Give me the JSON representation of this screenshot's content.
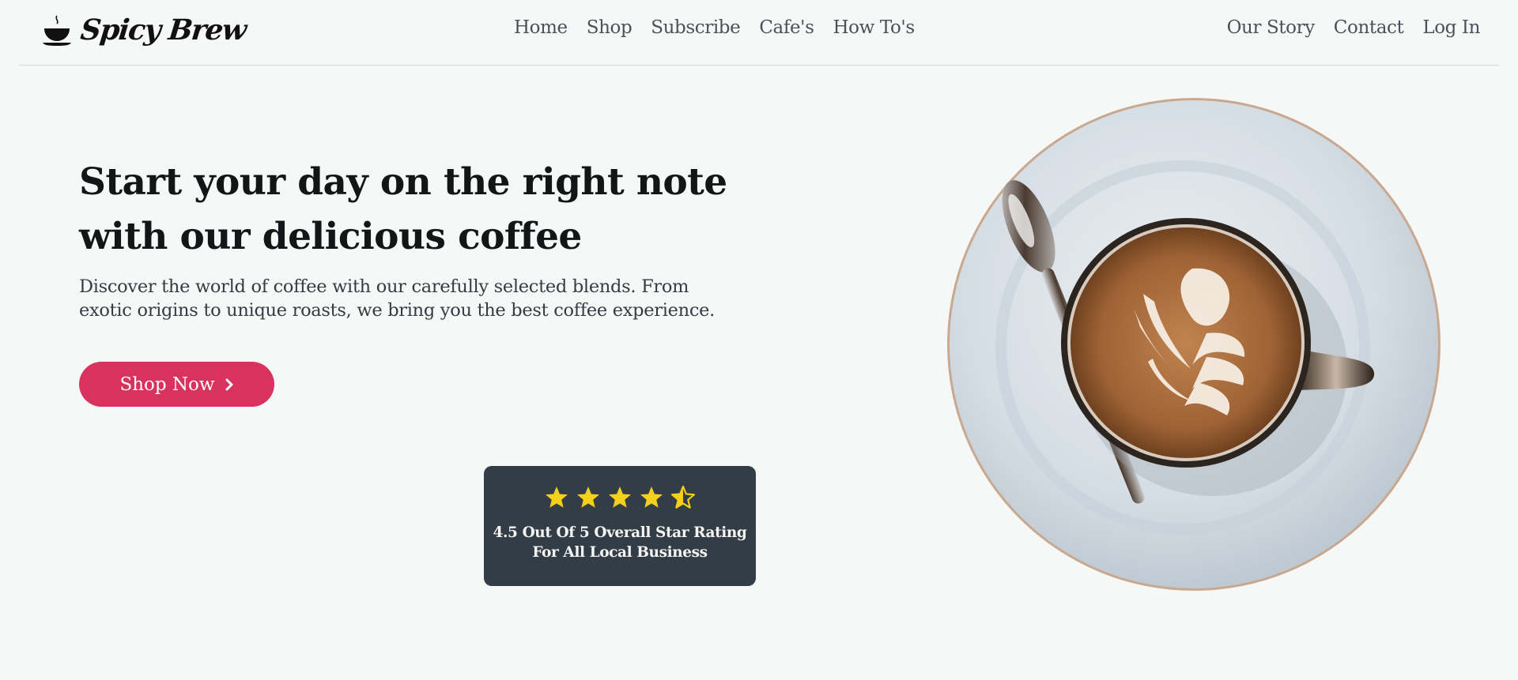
{
  "brand": {
    "name": "Spicy Brew",
    "icon": "coffee-cup-icon"
  },
  "nav": {
    "center": [
      "Home",
      "Shop",
      "Subscribe",
      "Cafe's",
      "How To's"
    ],
    "right": [
      "Our Story",
      "Contact",
      "Log In"
    ]
  },
  "hero": {
    "title_line1": "Start your day on the right note",
    "title_line2": "with our delicious coffee",
    "description_line1": "Discover the world of coffee with our carefully selected blends. From",
    "description_line2": "exotic origins to unique roasts, we bring you the best coffee experience.",
    "button_label": "Shop Now",
    "button_icon": "chevron-right-icon"
  },
  "rating": {
    "value": 4.5,
    "max": 5,
    "text_line1": "4.5 Out Of 5 Overall Star Rating",
    "text_line2": "For All Local Business"
  },
  "colors": {
    "accent": "#d7335e",
    "star": "#f5d01a",
    "card_bg": "#333d45",
    "page_bg": "#f6f8f7"
  },
  "image": {
    "subject": "latte-art-cup-on-saucer"
  }
}
